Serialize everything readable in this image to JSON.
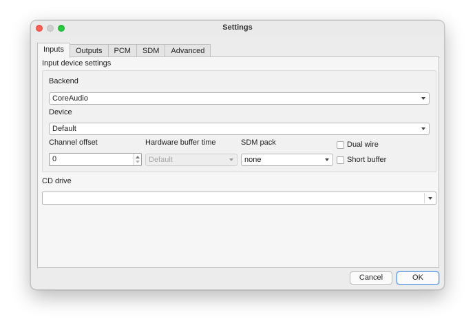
{
  "window": {
    "title": "Settings"
  },
  "tabs": [
    {
      "label": "Inputs",
      "active": true
    },
    {
      "label": "Outputs",
      "active": false
    },
    {
      "label": "PCM",
      "active": false
    },
    {
      "label": "SDM",
      "active": false
    },
    {
      "label": "Advanced",
      "active": false
    }
  ],
  "inputs": {
    "group_title": "Input device settings",
    "backend": {
      "label": "Backend",
      "value": "CoreAudio"
    },
    "device": {
      "label": "Device",
      "value": "Default"
    },
    "channel_offset": {
      "label": "Channel offset",
      "value": "0"
    },
    "hw_buffer": {
      "label": "Hardware buffer time",
      "value": "Default",
      "disabled": true
    },
    "sdm_pack": {
      "label": "SDM pack",
      "value": "none"
    },
    "dual_wire": {
      "label": "Dual wire",
      "checked": false
    },
    "short_buffer": {
      "label": "Short buffer",
      "checked": false
    },
    "cd_drive": {
      "label": "CD drive",
      "value": ""
    }
  },
  "buttons": {
    "cancel": "Cancel",
    "ok": "OK"
  },
  "colors": {
    "close": "#fe5f57",
    "maximize": "#28c840",
    "accent": "#5b9ae3"
  }
}
